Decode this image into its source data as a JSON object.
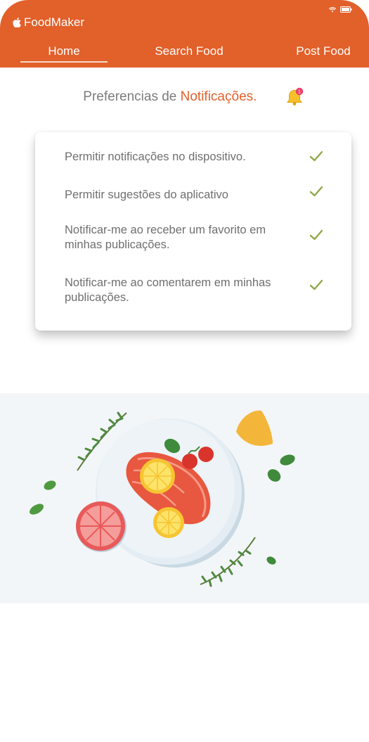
{
  "app": {
    "name": "FoodMaker"
  },
  "nav": {
    "tabs": [
      "Home",
      "Search Food",
      "Post Food"
    ],
    "active": "Home"
  },
  "page": {
    "title_prefix": "Preferencias de",
    "title_accent": "Notificações.",
    "bell_badge": "1"
  },
  "preferences": [
    {
      "label": "Permitir notificações no dispositivo.",
      "checked": true
    },
    {
      "label": "Permitir sugestões do aplicativo",
      "checked": true
    },
    {
      "label": "Notificar-me ao receber um favorito em minhas publicações.",
      "checked": true
    },
    {
      "label": "Notificar-me ao comentarem em minhas publicações.",
      "checked": true
    }
  ],
  "colors": {
    "brand": "#e2602a",
    "check": "#8fa84a",
    "text": "#6f6f6f"
  }
}
